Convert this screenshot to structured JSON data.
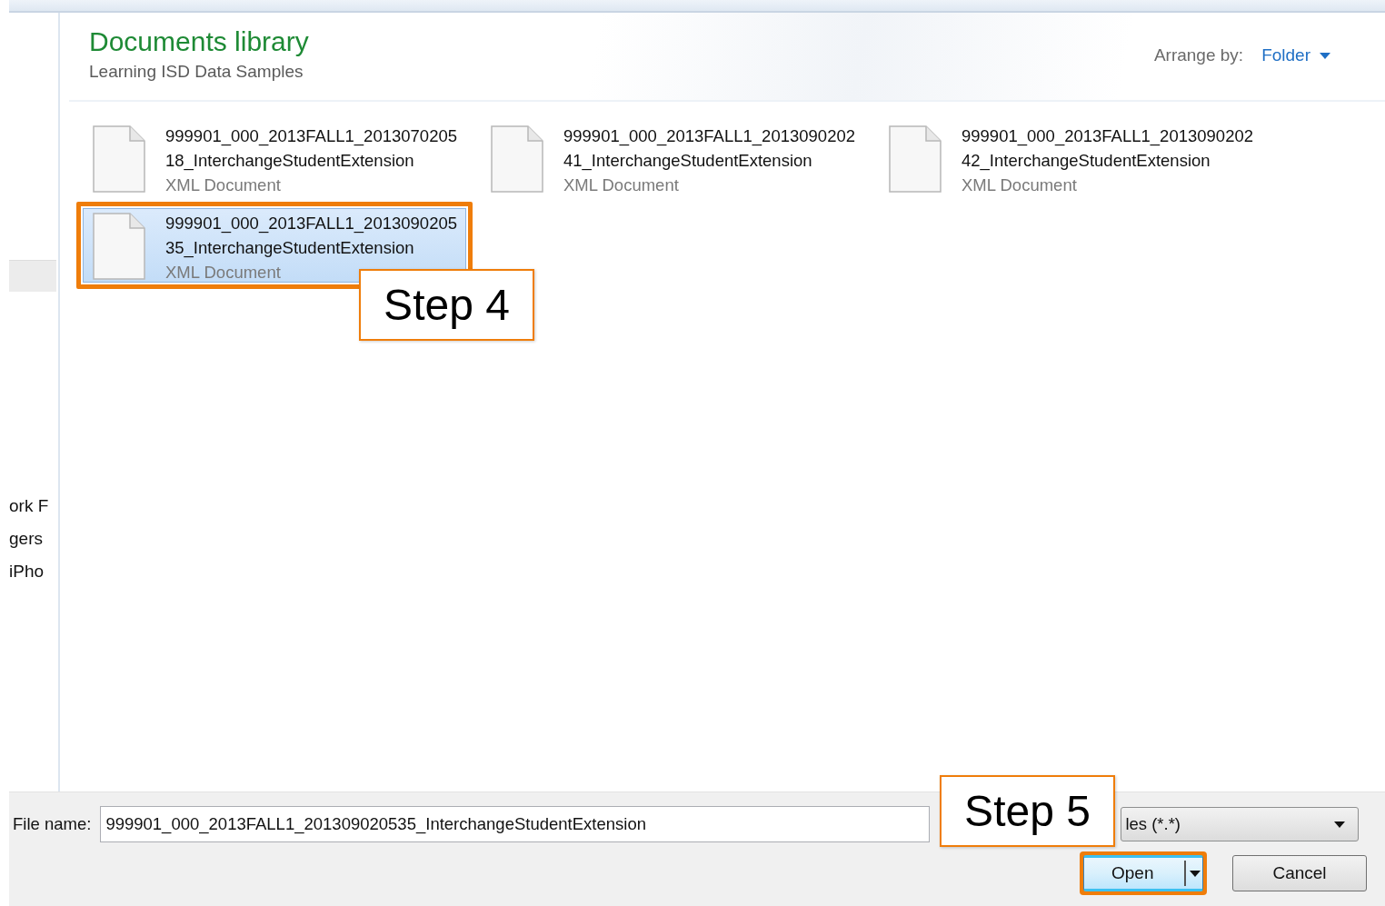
{
  "sidebar": {
    "items": [
      {
        "label": "ork F",
        "selected": false
      },
      {
        "label": "gers",
        "selected": false
      },
      {
        "label": "iPho",
        "selected": false
      }
    ]
  },
  "header": {
    "title": "Documents library",
    "subtitle": "Learning ISD Data Samples",
    "arrange_label": "Arrange by:",
    "arrange_value": "Folder"
  },
  "files": [
    {
      "name": [
        "999901_000_2013FALL1_2013070205",
        "18_InterchangeStudentExtension"
      ],
      "type": "XML Document",
      "selected": false,
      "highlighted": false
    },
    {
      "name": [
        "999901_000_2013FALL1_2013090202",
        "41_InterchangeStudentExtension"
      ],
      "type": "XML Document",
      "selected": false,
      "highlighted": false
    },
    {
      "name": [
        "999901_000_2013FALL1_2013090202",
        "42_InterchangeStudentExtension"
      ],
      "type": "XML Document",
      "selected": false,
      "highlighted": false
    },
    {
      "name": [
        "999901_000_2013FALL1_2013090205",
        "35_InterchangeStudentExtension"
      ],
      "type": "XML Document",
      "selected": true,
      "highlighted": true
    }
  ],
  "footer": {
    "file_name_label": "File name:",
    "file_name_value": "999901_000_2013FALL1_201309020535_InterchangeStudentExtension",
    "file_type": "les (*.*)",
    "buttons": [
      {
        "label": "Open",
        "kind": "split",
        "highlighted": true
      },
      {
        "label": "Cancel",
        "kind": "plain",
        "highlighted": false
      }
    ]
  },
  "annotations": [
    {
      "label": "Step 4"
    },
    {
      "label": "Step 5"
    }
  ]
}
